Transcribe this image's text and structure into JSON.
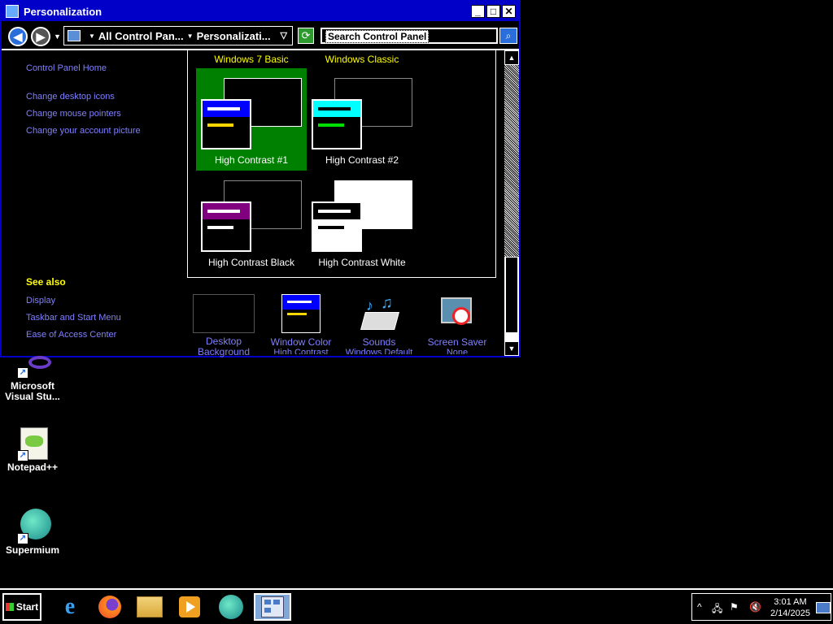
{
  "window": {
    "title": "Personalization",
    "minimize": "0",
    "maximize": "1",
    "close": "r"
  },
  "address": {
    "crumb1": "All Control Pan...",
    "crumb2": "Personalizati...",
    "search_placeholder": "Search Control Panel"
  },
  "left_pane": {
    "home": "Control Panel Home",
    "links": [
      "Change desktop icons",
      "Change mouse pointers",
      "Change your account picture"
    ],
    "see_also_title": "See also",
    "see_also": [
      "Display",
      "Taskbar and Start Menu",
      "Ease of Access Center"
    ]
  },
  "themes": {
    "top_labels": [
      "Windows 7 Basic",
      "Windows Classic"
    ],
    "items": [
      {
        "name": "High Contrast #1",
        "bar_color": "#0000ff",
        "line_color": "#ffd700",
        "selected": true
      },
      {
        "name": "High Contrast #2",
        "bar_color": "#00ffff",
        "line_color": "#00e000",
        "selected": false
      },
      {
        "name": "High Contrast Black",
        "bar_color": "#800080",
        "line_color": "#ffffff",
        "selected": false
      },
      {
        "name": "High Contrast White",
        "bar_color": "#000000",
        "line_color": "#000000",
        "selected": false
      }
    ]
  },
  "bottom": {
    "desktop_background": "Desktop Background",
    "window_color": "Window Color",
    "window_color_sub": "High Contrast",
    "sounds": "Sounds",
    "sounds_sub": "Windows Default",
    "screen_saver": "Screen Saver",
    "screen_saver_sub": "None"
  },
  "desktop": {
    "icons": [
      "Microsoft Visual Stu...",
      "Notepad++",
      "Supermium"
    ]
  },
  "taskbar": {
    "start": "Start",
    "time": "3:01 AM",
    "date": "2/14/2025"
  }
}
